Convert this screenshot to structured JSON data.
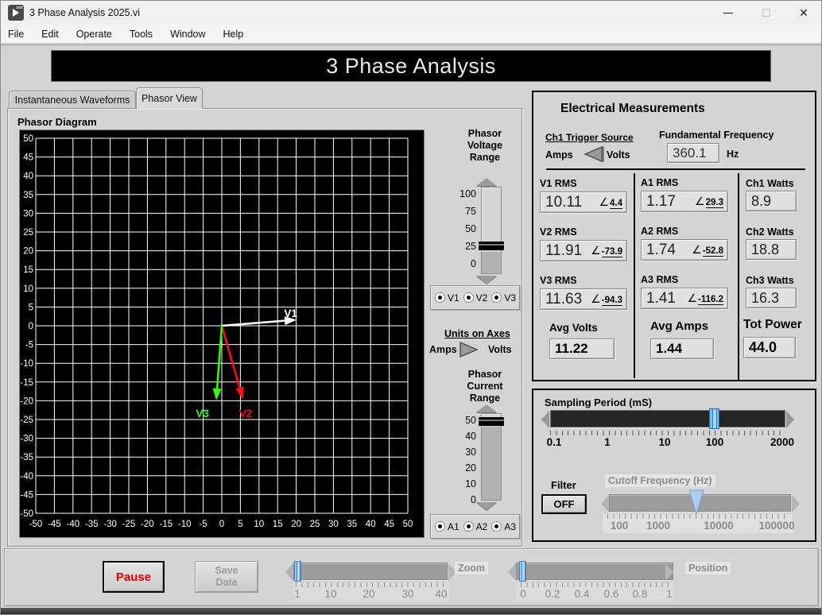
{
  "titlebar": {
    "title": "3 Phase Analysis 2025.vi",
    "close_glyph": "✕"
  },
  "menubar": {
    "items": [
      "File",
      "Edit",
      "Operate",
      "Tools",
      "Window",
      "Help"
    ]
  },
  "banner": {
    "title": "3 Phase Analysis"
  },
  "tabs": {
    "inactive": "Instantaneous Waveforms",
    "active": "Phasor View"
  },
  "phasor": {
    "title": "Phasor Diagram",
    "voltage_range": {
      "title": [
        "Phasor",
        "Voltage",
        "Range"
      ],
      "ticks": [
        "100",
        "75",
        "50",
        "25",
        "0"
      ],
      "value": 27
    },
    "voltage_channels": [
      {
        "label": "V1"
      },
      {
        "label": "V2"
      },
      {
        "label": "V3"
      }
    ],
    "units_switch": {
      "title": "Units on Axes",
      "left": "Amps",
      "right": "Volts",
      "selected": "Volts"
    },
    "current_range": {
      "title": [
        "Phasor",
        "Current",
        "Range"
      ],
      "ticks": [
        "50",
        "40",
        "30",
        "20",
        "10",
        "0"
      ],
      "value": 48
    },
    "current_channels": [
      {
        "label": "A1"
      },
      {
        "label": "A2"
      },
      {
        "label": "A3"
      }
    ]
  },
  "chart_data": {
    "type": "scatter",
    "title": "Phasor Diagram",
    "xlim": [
      -50,
      50
    ],
    "ylim": [
      -50,
      50
    ],
    "tick_step": 5,
    "grid": true,
    "background": "#000000",
    "grid_color": "#ffffff",
    "vectors": [
      {
        "name": "V1",
        "color": "#ffffff",
        "magnitude": 10.11,
        "angle_deg": 4.4,
        "end": [
          20.1,
          1.6
        ],
        "label_at": [
          18.5,
          3.4
        ]
      },
      {
        "name": "V2",
        "color": "#ff1010",
        "magnitude": 11.91,
        "angle_deg": -73.9,
        "end": [
          5.7,
          -19.6
        ],
        "label_at": [
          6.4,
          -23.3
        ]
      },
      {
        "name": "V3",
        "color": "#2eff00",
        "magnitude": 11.63,
        "angle_deg": -94.3,
        "end": [
          -1.5,
          -19.9
        ],
        "label_at": [
          -5.2,
          -23.3
        ]
      }
    ]
  },
  "measurements": {
    "title": "Electrical Measurements",
    "angle_symbol": "∠",
    "trigger": {
      "label": "Ch1 Trigger Source",
      "left": "Amps",
      "right": "Volts"
    },
    "fundamental": {
      "label": "Fundamental Frequency",
      "value": "360.1",
      "unit": "Hz"
    },
    "rms": [
      {
        "label": "V1 RMS",
        "value": "10.11",
        "angle": "4.4"
      },
      {
        "label": "V2 RMS",
        "value": "11.91",
        "angle": "-73.9"
      },
      {
        "label": "V3 RMS",
        "value": "11.63",
        "angle": "-94.3"
      },
      {
        "label": "A1 RMS",
        "value": "1.17",
        "angle": "29.3"
      },
      {
        "label": "A2 RMS",
        "value": "1.74",
        "angle": "-52.8"
      },
      {
        "label": "A3 RMS",
        "value": "1.41",
        "angle": "-116.2"
      }
    ],
    "watts": [
      {
        "label": "Ch1 Watts",
        "value": "8.9"
      },
      {
        "label": "Ch2 Watts",
        "value": "18.8"
      },
      {
        "label": "Ch3 Watts",
        "value": "16.3"
      }
    ],
    "averages": [
      {
        "label": "Avg Volts",
        "value": "11.22"
      },
      {
        "label": "Avg Amps",
        "value": "1.44"
      },
      {
        "label": "Tot Power",
        "value": "44.0"
      }
    ]
  },
  "sampling": {
    "label": "Sampling Period (mS)",
    "ticks": [
      "0.1",
      "1",
      "10",
      "100",
      "2000"
    ],
    "filter": {
      "label": "Filter",
      "button": "OFF"
    },
    "cutoff": {
      "label": "Cutoff Frequency (Hz)",
      "ticks": [
        "100",
        "1000",
        "10000",
        "100000"
      ]
    }
  },
  "footer": {
    "pause": "Pause",
    "save": "Save Data",
    "zoom": {
      "label": "Zoom",
      "ticks": [
        "1",
        "10",
        "20",
        "30",
        "40"
      ]
    },
    "position": {
      "label": "Position",
      "ticks": [
        "0",
        "0.2",
        "0.4",
        "0.6",
        "0.8",
        "1"
      ]
    }
  }
}
